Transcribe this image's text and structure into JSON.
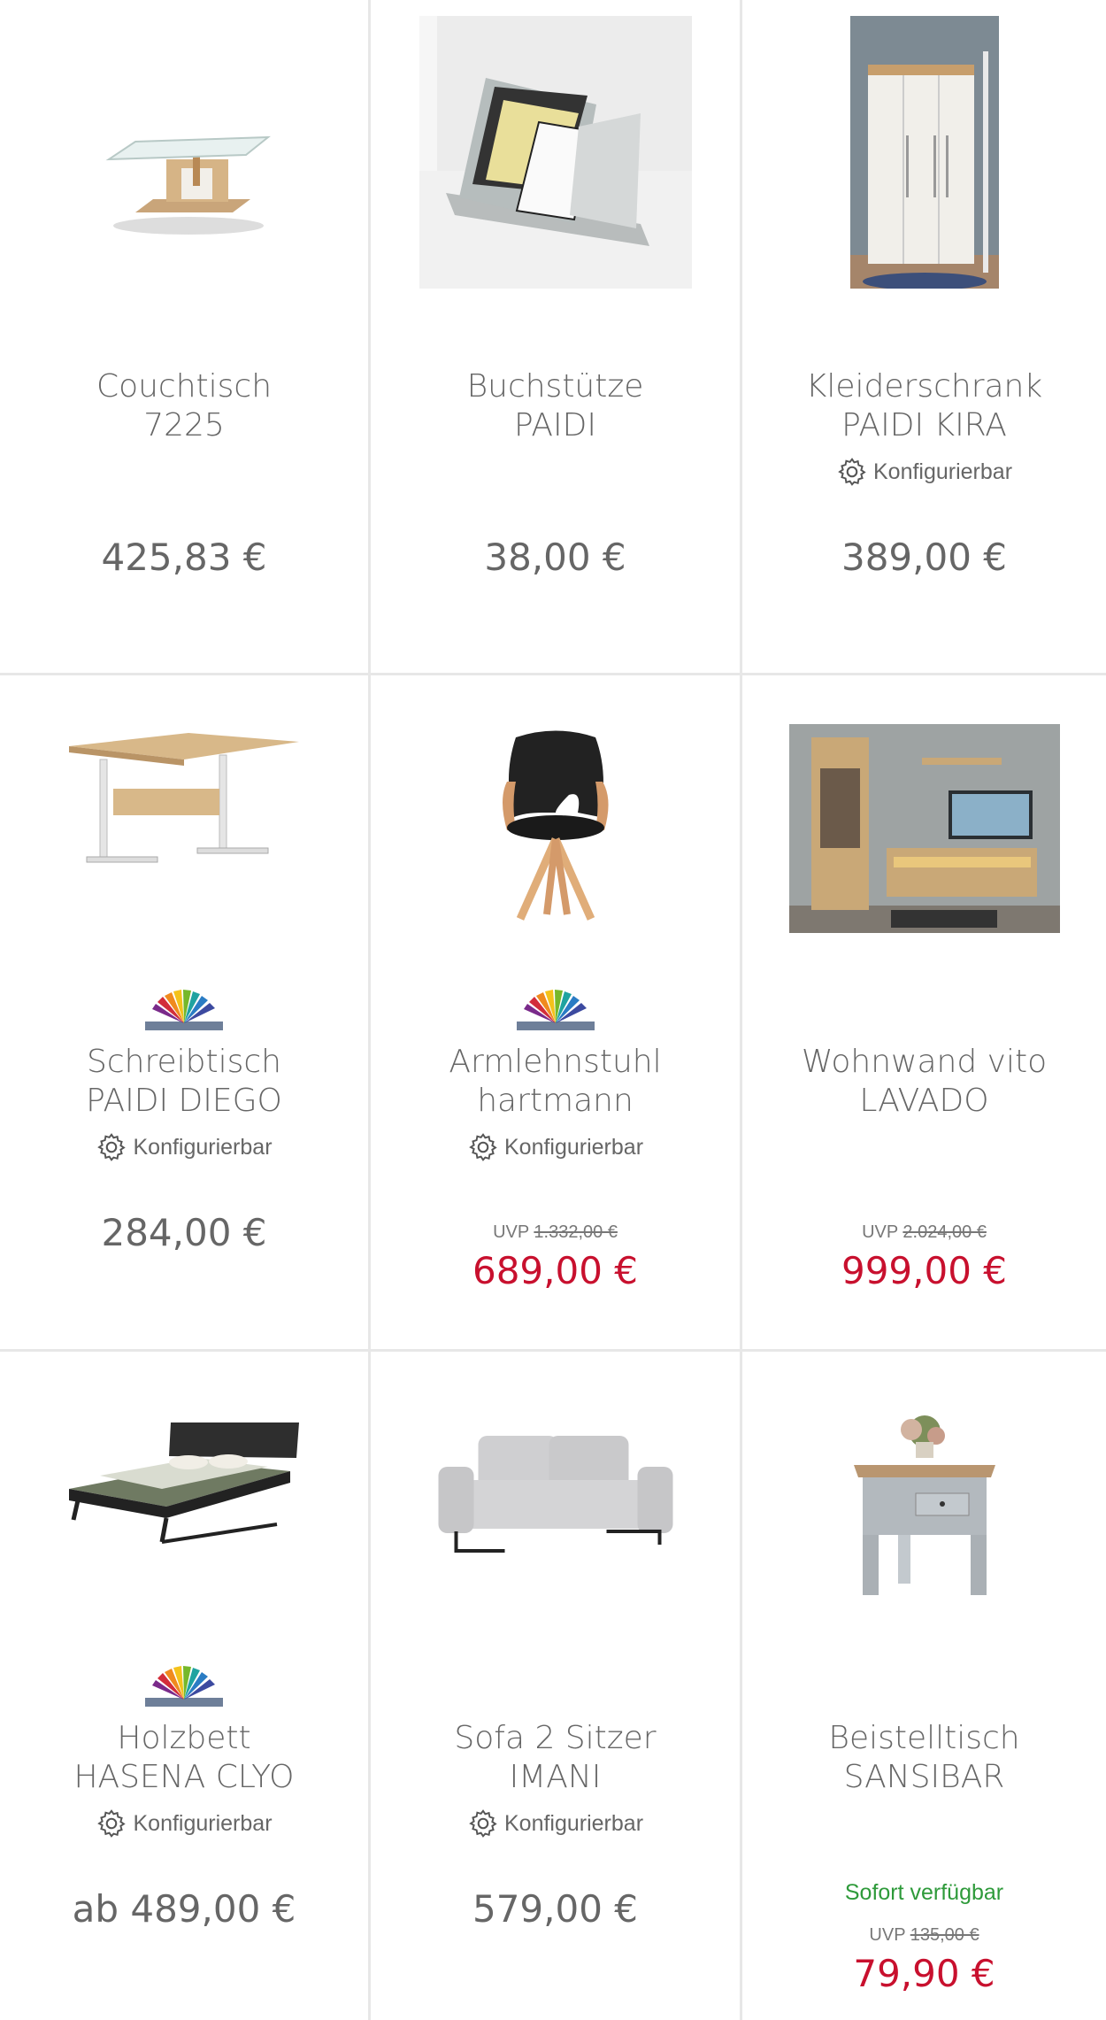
{
  "products": [
    {
      "name_line1": "Couchtisch",
      "name_line2": "7225",
      "price": "425,83 €"
    },
    {
      "name_line1": "Buchstütze",
      "name_line2": "PAIDI",
      "price": "38,00 €"
    },
    {
      "name_line1": "Kleiderschrank",
      "name_line2": "PAIDI KIRA",
      "config_label": "Konfigurierbar",
      "price": "389,00 €"
    },
    {
      "name_line1": "Schreibtisch",
      "name_line2": "PAIDI DIEGO",
      "config_label": "Konfigurierbar",
      "price": "284,00 €"
    },
    {
      "name_line1": "Armlehnstuhl",
      "name_line2": "hartmann",
      "config_label": "Konfigurierbar",
      "uvp_label": "UVP",
      "uvp_price": "1.332,00 €",
      "sale_price": "689,00 €"
    },
    {
      "name_line1": "Wohnwand vito",
      "name_line2": "LAVADO",
      "uvp_label": "UVP",
      "uvp_price": "2.024,00 €",
      "sale_price": "999,00 €"
    },
    {
      "name_line1": "Holzbett",
      "name_line2": "HASENA CLYO",
      "config_label": "Konfigurierbar",
      "price": "ab 489,00 €"
    },
    {
      "name_line1": "Sofa 2 Sitzer",
      "name_line2": "IMANI",
      "config_label": "Konfigurierbar",
      "price": "579,00 €"
    },
    {
      "name_line1": "Beistelltisch",
      "name_line2": "SANSIBAR",
      "availability": "Sofort verfügbar",
      "uvp_label": "UVP",
      "uvp_price": "135,00 €",
      "sale_price": "79,90 €"
    }
  ],
  "colors": {
    "sale": "#c8102e",
    "available": "#2e9a3a",
    "text": "#666666",
    "divider": "#e7e7e7"
  }
}
